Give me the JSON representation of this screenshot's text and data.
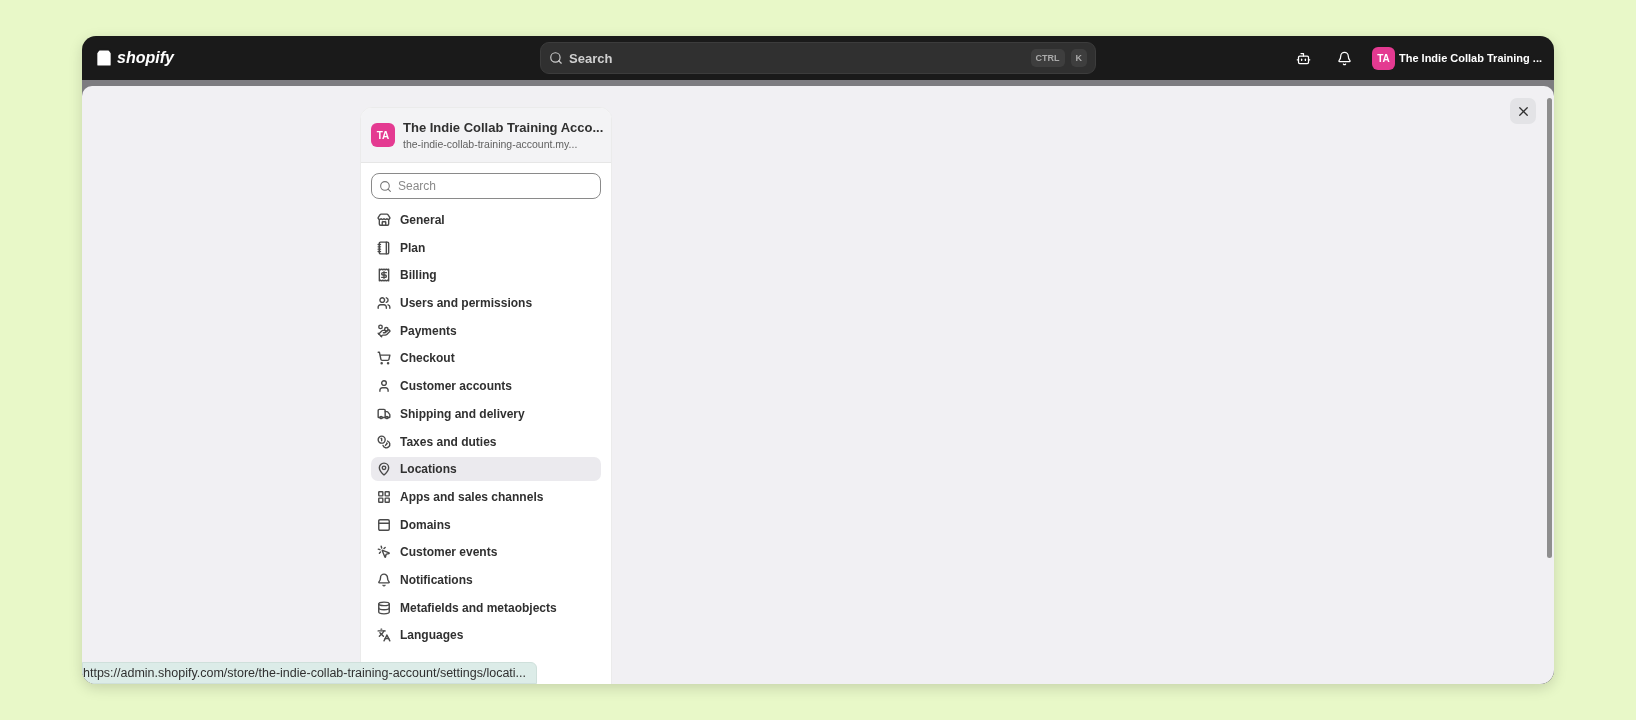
{
  "top_bar": {
    "logo": "shopify",
    "search": {
      "placeholder": "Search",
      "shortcut": [
        "CTRL",
        "K"
      ]
    },
    "account": {
      "initials": "TA",
      "name": "The Indie Collab Training ..."
    }
  },
  "settings_panel": {
    "store": {
      "initials": "TA",
      "name": "The Indie Collab Training Acco...",
      "domain": "the-indie-collab-training-account.my..."
    },
    "search": {
      "placeholder": "Search"
    },
    "items": [
      {
        "label": "General",
        "selected": false
      },
      {
        "label": "Plan",
        "selected": false
      },
      {
        "label": "Billing",
        "selected": false
      },
      {
        "label": "Users and permissions",
        "selected": false
      },
      {
        "label": "Payments",
        "selected": false
      },
      {
        "label": "Checkout",
        "selected": false
      },
      {
        "label": "Customer accounts",
        "selected": false
      },
      {
        "label": "Shipping and delivery",
        "selected": false
      },
      {
        "label": "Taxes and duties",
        "selected": false
      },
      {
        "label": "Locations",
        "selected": true
      },
      {
        "label": "Apps and sales channels",
        "selected": false
      },
      {
        "label": "Domains",
        "selected": false
      },
      {
        "label": "Customer events",
        "selected": false
      },
      {
        "label": "Notifications",
        "selected": false
      },
      {
        "label": "Metafields and metaobjects",
        "selected": false
      },
      {
        "label": "Languages",
        "selected": false
      }
    ]
  },
  "status_url": "https://admin.shopify.com/store/the-indie-collab-training-account/settings/locati..."
}
